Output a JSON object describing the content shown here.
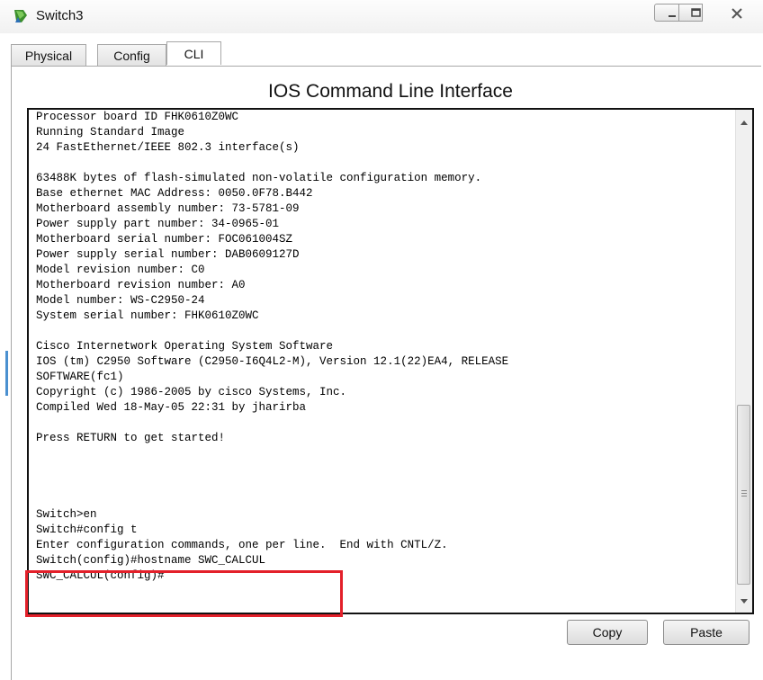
{
  "window": {
    "title": "Switch3",
    "icon": "switch-device-icon",
    "controls": {
      "minimize": "minimize-icon",
      "maximize": "maximize-icon",
      "close": "close-icon"
    }
  },
  "tabs": [
    {
      "label": "Physical"
    },
    {
      "label": "Config"
    },
    {
      "label": "CLI"
    }
  ],
  "active_tab": "CLI",
  "cli": {
    "heading": "IOS Command Line Interface",
    "lines": [
      "Processor board ID FHK0610Z0WC",
      "Running Standard Image",
      "24 FastEthernet/IEEE 802.3 interface(s)",
      "",
      "63488K bytes of flash-simulated non-volatile configuration memory.",
      "Base ethernet MAC Address: 0050.0F78.B442",
      "Motherboard assembly number: 73-5781-09",
      "Power supply part number: 34-0965-01",
      "Motherboard serial number: FOC061004SZ",
      "Power supply serial number: DAB0609127D",
      "Model revision number: C0",
      "Motherboard revision number: A0",
      "Model number: WS-C2950-24",
      "System serial number: FHK0610Z0WC",
      "",
      "Cisco Internetwork Operating System Software",
      "IOS (tm) C2950 Software (C2950-I6Q4L2-M), Version 12.1(22)EA4, RELEASE",
      "SOFTWARE(fc1)",
      "Copyright (c) 1986-2005 by cisco Systems, Inc.",
      "Compiled Wed 18-May-05 22:31 by jharirba",
      "",
      "Press RETURN to get started!",
      "",
      "",
      "",
      "",
      "Switch>en",
      "Switch#config t",
      "Enter configuration commands, one per line.  End with CNTL/Z.",
      "Switch(config)#hostname SWC_CALCUL",
      "SWC_CALCUL(config)#"
    ],
    "highlight_color": "#e3202a"
  },
  "buttons": {
    "copy": "Copy",
    "paste": "Paste"
  }
}
